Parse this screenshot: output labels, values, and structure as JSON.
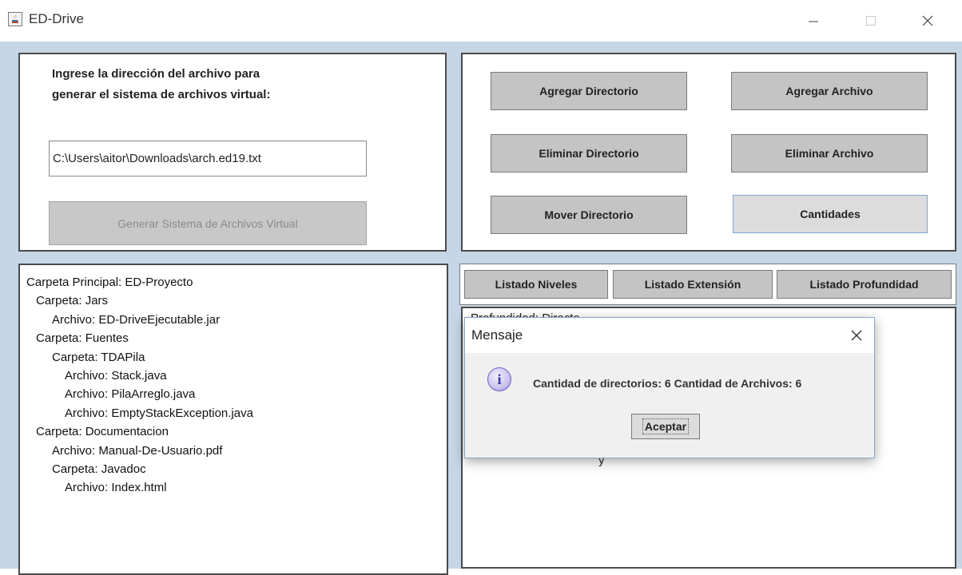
{
  "window": {
    "title": "ED-Drive"
  },
  "input_panel": {
    "instruction_line1": "Ingrese la dirección del archivo para",
    "instruction_line2": "generar el sistema de archivos virtual:",
    "path_value": "C:\\Users\\aitor\\Downloads\\arch.ed19.txt",
    "generate_button": "Generar Sistema de Archivos Virtual"
  },
  "actions": {
    "add_directory": "Agregar Directorio",
    "add_file": "Agregar Archivo",
    "delete_directory": "Eliminar Directorio",
    "delete_file": "Eliminar Archivo",
    "move_directory": "Mover Directorio",
    "counts": "Cantidades"
  },
  "tree": {
    "items": [
      "Carpeta Principal: ED-Proyecto",
      "Carpeta: Jars",
      "Archivo: ED-DriveEjecutable.jar",
      "Carpeta: Fuentes",
      "Carpeta: TDAPila",
      "Archivo: Stack.java",
      "Archivo: PilaArreglo.java",
      "Archivo: EmptyStackException.java",
      "Carpeta: Documentacion",
      "Archivo: Manual-De-Usuario.pdf",
      "Carpeta: Javadoc",
      "Archivo: Index.html"
    ]
  },
  "listing": {
    "levels_button": "Listado Niveles",
    "extension_button": "Listado Extensión",
    "depth_button": "Listado Profundidad",
    "partial_text_top": "Profundidad: Directo",
    "partial_text_bottom": "y"
  },
  "dialog": {
    "title": "Mensaje",
    "message": "Cantidad de directorios: 6 Cantidad de Archivos: 6",
    "ok_button": "Aceptar",
    "icon": "information-icon"
  }
}
